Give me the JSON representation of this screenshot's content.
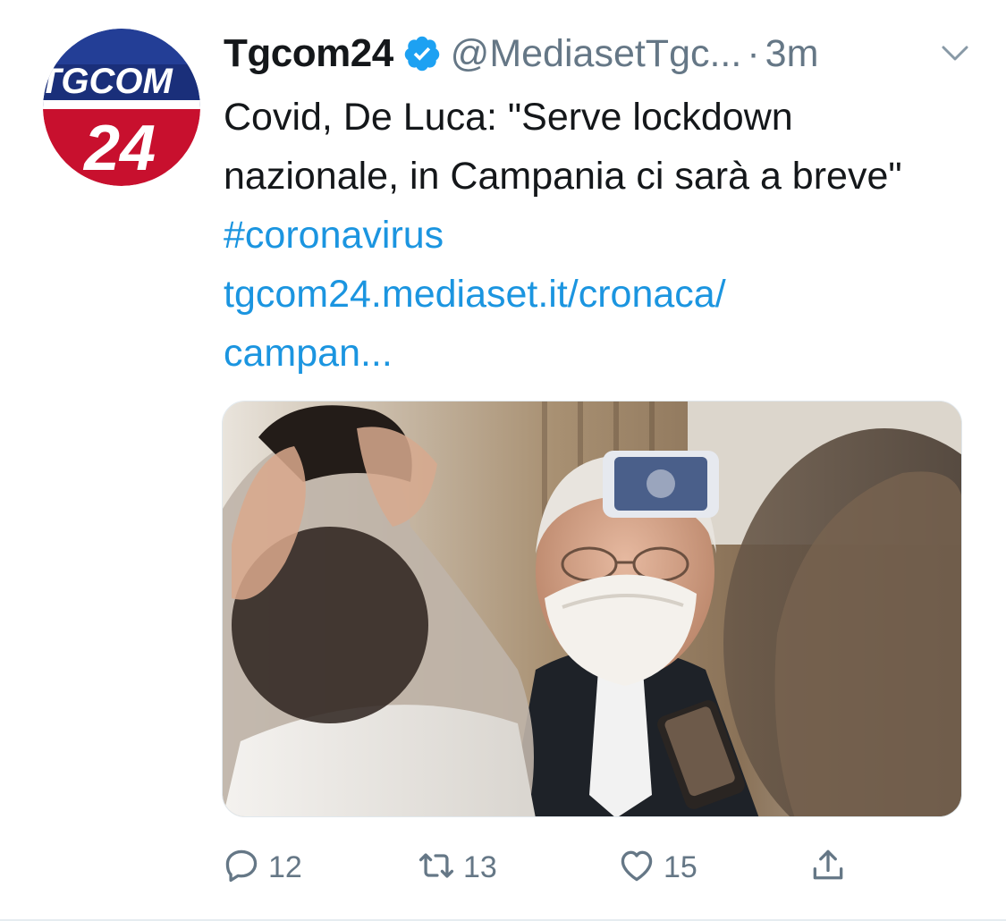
{
  "tweet": {
    "author_name": "Tgcom24",
    "handle": "@MediasetTgc...",
    "separator": "·",
    "time": "3m",
    "avatar": {
      "text_top": "TGCOM",
      "text_bottom": "24"
    },
    "text_main": "Covid, De Luca: \"Serve lockdown nazionale, in Campania ci sarà a breve\"",
    "hashtag": "#coronavirus",
    "link_line1": "tgcom24.mediaset.it/cronaca/",
    "link_line2": "campan...",
    "actions": {
      "reply_count": "12",
      "retweet_count": "13",
      "like_count": "15"
    }
  },
  "colors": {
    "accent": "#1b95e0",
    "muted": "#657786",
    "text": "#14171a",
    "avatar_blue": "#1a2f7a",
    "avatar_red": "#c8102e"
  },
  "icons": {
    "verified": "verified-badge-icon",
    "caret": "chevron-down-icon",
    "reply": "reply-icon",
    "retweet": "retweet-icon",
    "like": "heart-icon",
    "share": "share-icon"
  }
}
